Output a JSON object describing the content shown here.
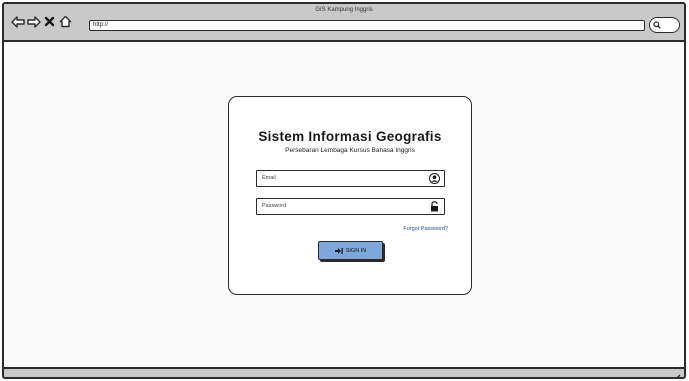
{
  "browser": {
    "title": "GIS Kampung Inggris",
    "url": "http://"
  },
  "login": {
    "title": "Sistem Informasi Geografis",
    "subtitle": "Persebaran Lembaga Kursus Bahasa Inggris",
    "email_placeholder": "Email",
    "password_placeholder": "Password",
    "forgot_label": "Forgot Password?",
    "signin_label": "SIGN IN"
  },
  "icons": {
    "back": "back-arrow-icon",
    "forward": "forward-arrow-icon",
    "stop": "close-icon",
    "home": "home-icon",
    "search": "search-icon",
    "user": "user-icon",
    "lock": "unlock-icon",
    "signin": "sign-in-icon",
    "resize": "resize-grip-icon"
  },
  "colors": {
    "chrome": "#c9c9c9",
    "button": "#7ea8dc",
    "link": "#1f4fa3",
    "border": "#2b2b2b"
  }
}
